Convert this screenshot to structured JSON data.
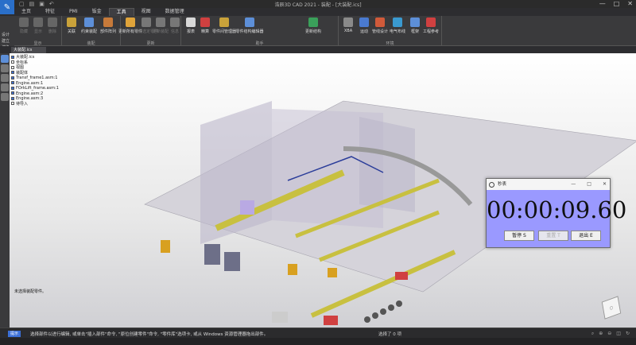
{
  "window": {
    "title": "浩辰3D CAD 2021 - 装配 - [大装配.ics]",
    "controls": [
      "—",
      "□",
      "✕"
    ]
  },
  "menu": {
    "tabs": [
      "主页",
      "特征",
      "PMI",
      "钣金",
      "工具",
      "视图",
      "数据管理"
    ],
    "active": "工具"
  },
  "ribbon": {
    "groups": [
      {
        "label": "显示",
        "buttons": [
          "隐藏",
          "显示",
          "删除"
        ]
      },
      {
        "label": "装配",
        "buttons": [
          "关联",
          "约束装配",
          "部件阵列"
        ]
      },
      {
        "label": "更新",
        "buttons": [
          "更新所有零件",
          "更新选定零件",
          "更新装配",
          "信息"
        ]
      },
      {
        "label": "助手",
        "buttons": [
          "报表",
          "精算",
          "零件间管理器",
          "零件结构编辑器",
          "更新结构"
        ]
      },
      {
        "label": "环境",
        "buttons": [
          "XBA",
          "运动",
          "管线设计",
          "电气布线",
          "框架",
          "工程参考"
        ]
      }
    ],
    "left_items": [
      "设计",
      "建立",
      "渲染"
    ]
  },
  "doc_tab": "大装配.ics",
  "tree": {
    "items": [
      "大装配.ics",
      "坐标系",
      "视图",
      "装配体",
      "Transf_frame1.asm:1",
      "Engine.asm:1",
      "FOrkLift_frame.asm:1",
      "Engine.asm:2",
      "Engine.asm:3",
      "待导入"
    ]
  },
  "viewport": {
    "hint": "未选择装配零件。"
  },
  "statusbar": {
    "tag": "提示",
    "text": "选择部件以进行编辑, 或单击\"插入部件\"命令, \"原位创建零件\"命令, \"零件库\"选项卡, 或从 Windows 资源管理器拖出部件。",
    "count": "选择了 0 项"
  },
  "stopwatch": {
    "title": "秒表",
    "time": "00:00:09.60",
    "buttons": {
      "pause": "暂停 S",
      "reset": "重置 T",
      "exit": "退出 E"
    },
    "bg_color": "#9a99ff"
  }
}
